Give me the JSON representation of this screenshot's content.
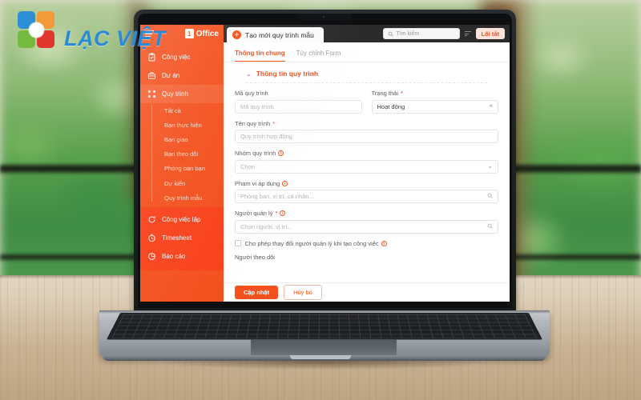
{
  "watermark": {
    "brand": "LẠC VIỆT"
  },
  "app": {
    "topbar": {
      "menu_icon": "hamburger-icon",
      "office_mark": "1",
      "office_label": "Office",
      "tab": {
        "icon": "plus-circle-icon",
        "label": "Tạo mới quy trình mẫu"
      },
      "search": {
        "icon": "search-icon",
        "placeholder": "Tìm kiếm",
        "filter_icon": "filter-icon"
      },
      "shortcut_button": "Lối tắt"
    },
    "sidebar": {
      "items": [
        {
          "label": "Công việc",
          "icon": "clipboard-icon"
        },
        {
          "label": "Dự án",
          "icon": "briefcase-icon"
        },
        {
          "label": "Quy trình",
          "icon": "workflow-icon",
          "active": true
        }
      ],
      "sub_items": [
        {
          "label": "Tất cả"
        },
        {
          "label": "Bạn thực hiện"
        },
        {
          "label": "Bạn giao"
        },
        {
          "label": "Bạn theo dõi"
        },
        {
          "label": "Phòng ban bạn"
        },
        {
          "label": "Dự kiến"
        },
        {
          "label": "Quy trình mẫu"
        }
      ],
      "lower_items": [
        {
          "label": "Công việc lặp",
          "icon": "repeat-icon"
        },
        {
          "label": "Timesheet",
          "icon": "clock-icon"
        },
        {
          "label": "Báo cáo",
          "icon": "report-chart-icon"
        }
      ]
    },
    "content": {
      "tabs": [
        {
          "label": "Thông tin chung",
          "active": true
        },
        {
          "label": "Tùy chỉnh Form",
          "active": false
        }
      ],
      "section": {
        "chevron": "chevron-down-icon",
        "title": "Thông tin quy trình"
      },
      "fields": {
        "code": {
          "label": "Mã quy trình",
          "placeholder": "Mã quy trình",
          "required": false
        },
        "status": {
          "label": "Trạng thái",
          "value": "Hoạt động",
          "required": true,
          "clear_icon": "×"
        },
        "name": {
          "label": "Tên quy trình",
          "placeholder": "Quy trình hợp đồng",
          "required": true
        },
        "group": {
          "label": "Nhóm quy trình",
          "placeholder": "Chọn",
          "info": true,
          "caret": "chevron-down-icon"
        },
        "scope": {
          "label": "Phạm vi áp dụng",
          "placeholder": "Phòng ban, vị trí, cá nhân...",
          "info": true,
          "search_icon": "search-icon"
        },
        "manager": {
          "label": "Người quản lý",
          "placeholder": "Chọn người, vị trí...",
          "required": true,
          "info": true,
          "search_icon": "search-icon"
        },
        "allow_change": {
          "label": "Cho phép thay đổi người quản lý khi tạo công việc",
          "info": true,
          "checked": false
        },
        "followers": {
          "label": "Người theo dõi"
        }
      },
      "buttons": {
        "submit": "Cập nhật",
        "cancel": "Hủy bỏ"
      }
    }
  },
  "theme": {
    "accent": "#F4511E",
    "accent_soft": "#fde3da",
    "logo_blue": "#2b8ad6"
  }
}
